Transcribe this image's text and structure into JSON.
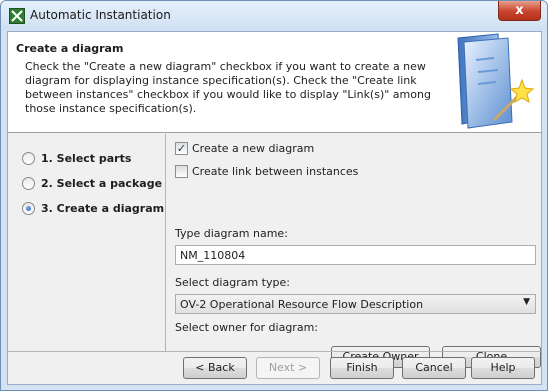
{
  "window": {
    "title": "Automatic Instantiation",
    "close_label": "x"
  },
  "header": {
    "title": "Create a diagram",
    "description": "Check the \"Create a new diagram\" checkbox if you want to create a new diagram for displaying instance specification(s). Check the \"Create link between instances\" checkbox if you would like to display \"Link(s)\" among those instance specification(s)."
  },
  "steps": [
    {
      "label": "1. Select parts",
      "selected": false
    },
    {
      "label": "2. Select a package",
      "selected": false
    },
    {
      "label": "3. Create a diagram",
      "selected": true
    }
  ],
  "options": {
    "create_diagram": {
      "label": "Create a new diagram",
      "checked": true
    },
    "create_link": {
      "label": "Create link between instances",
      "checked": false
    }
  },
  "form": {
    "name_label": "Type diagram name:",
    "name_value": "NM_110804",
    "type_label": "Select diagram type:",
    "type_value": "OV-2 Operational Resource Flow Description",
    "owner_label": "Select owner for diagram:",
    "create_owner_label": "Create Owner",
    "clone_label": "Clone"
  },
  "footer": {
    "back_label": "< Back",
    "next_label": "Next >",
    "finish_label": "Finish",
    "cancel_label": "Cancel",
    "help_label": "Help"
  }
}
